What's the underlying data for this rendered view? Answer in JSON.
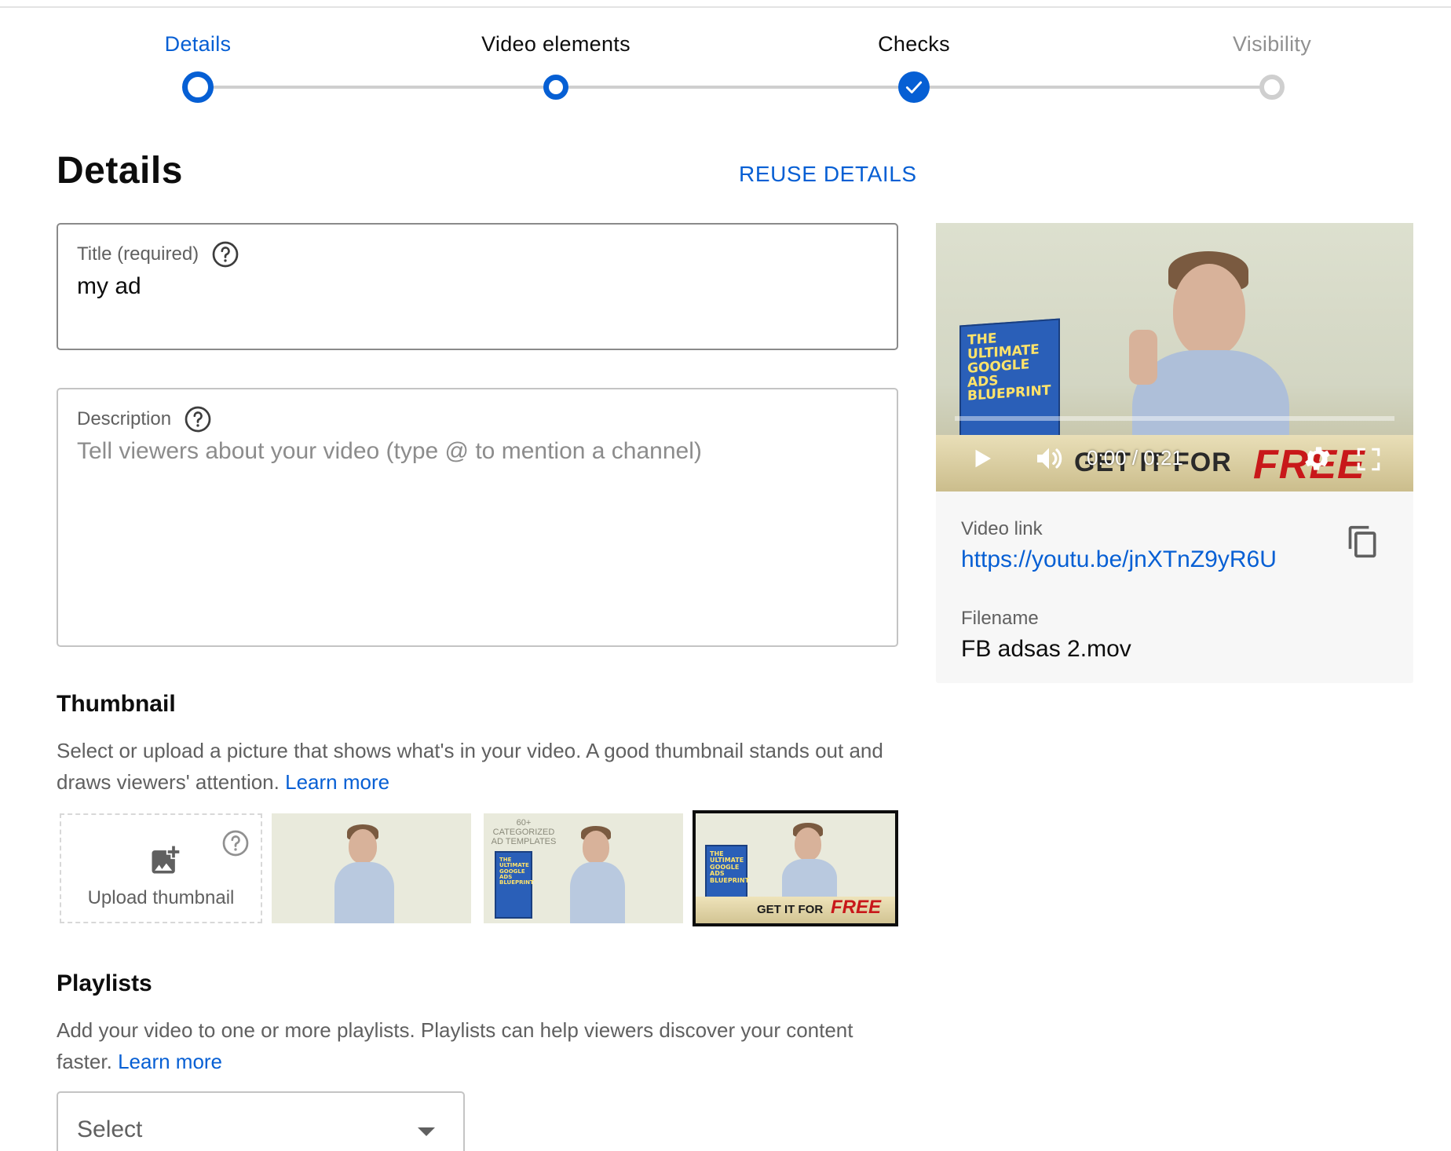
{
  "stepper": {
    "steps": [
      {
        "label": "Details",
        "state": "current"
      },
      {
        "label": "Video elements",
        "state": "visited"
      },
      {
        "label": "Checks",
        "state": "done"
      },
      {
        "label": "Visibility",
        "state": "upcoming"
      }
    ]
  },
  "header": {
    "title": "Details",
    "reuse_label": "REUSE DETAILS"
  },
  "title_field": {
    "label": "Title (required)",
    "value": "my ad"
  },
  "description_field": {
    "label": "Description",
    "placeholder": "Tell viewers about your video (type @ to mention a channel)"
  },
  "thumbnail": {
    "heading": "Thumbnail",
    "text": "Select or upload a picture that shows what's in your video. A good thumbnail stands out and draws viewers' attention.",
    "learn_more": "Learn more",
    "upload_label": "Upload thumbnail",
    "thumb2_overlay": "60+\nCATEGORIZED\nAD TEMPLATES",
    "thumb3_get": "GET IT FOR",
    "thumb3_free": "FREE",
    "book_text": "THE ULTIMATE GOOGLE ADS BLUEPRINT"
  },
  "playlists": {
    "heading": "Playlists",
    "text": "Add your video to one or more playlists. Playlists can help viewers discover your content faster.",
    "learn_more": "Learn more",
    "select_value": "Select"
  },
  "video": {
    "time": "0:00 / 0:21",
    "banner_get": "GET IT FOR",
    "banner_free": "FREE",
    "progress_fraction": 0,
    "link_label": "Video link",
    "link_value": "https://youtu.be/jnXTnZ9yR6U",
    "filename_label": "Filename",
    "filename_value": "FB adsas 2.mov"
  },
  "colors": {
    "accent": "#065fd4",
    "upcoming": "#cfcfcf",
    "muted_text": "#606060"
  }
}
